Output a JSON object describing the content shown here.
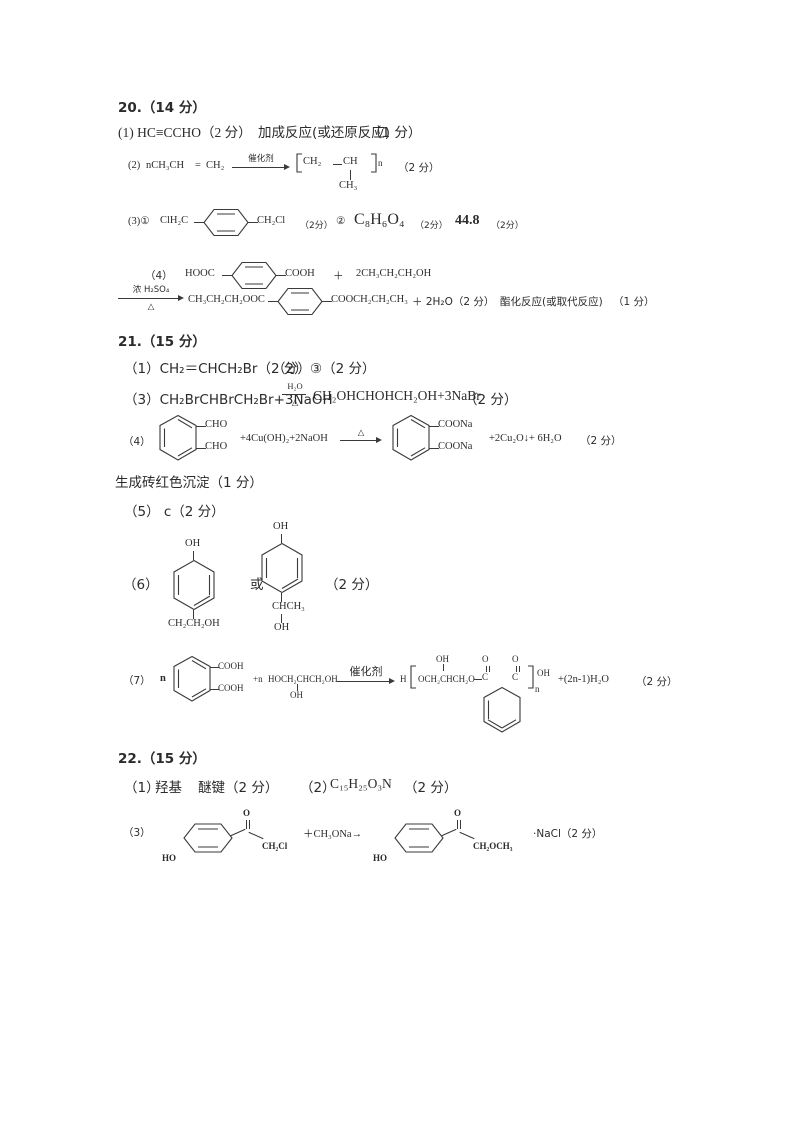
{
  "document": {
    "type": "chemistry-answer-key",
    "language": "zh-CN"
  },
  "q20": {
    "heading": "20.（14 分）",
    "line1_prefix": "(1) HC≡CCHO（2 分）",
    "line1_reaction_type": "加成反应(或还原反应)",
    "line1_score": "（1 分）",
    "line2_label": "(2)",
    "line2_reactant": "nCH₃CH",
    "line2_double_bond": "=",
    "line2_reactant_tail": "CH₂",
    "line2_condition": "催化剂",
    "line2_product_unit1": "CH₂",
    "line2_product_unit2": "CH",
    "line2_product_branch": "CH₃",
    "line2_product_sub": "n",
    "line2_score": "（2 分）",
    "line3_label": "(3)①",
    "line3_left": "ClH₂C",
    "line3_right": "CH₂Cl",
    "line3_score1": "（2分）",
    "line3_marker2": "②",
    "line3_formula2": "C₈H₆O₄",
    "line3_score2": "（2分）",
    "line3_value3": "44.8",
    "line3_score3": "（2分）",
    "line4_label": "（4）",
    "line4_left": "HOOC",
    "line4_right": "COOH",
    "line4_plus": "＋",
    "line4_alcohol": "2CH₃CH₂CH₂OH",
    "line5_cond_top": "浓 H₂SO₄",
    "line5_cond_bottom": "△",
    "line5_ester_left": "CH₃CH₂CH₂OOC",
    "line5_ester_right": "COOCH₂CH₂CH₃",
    "line5_water": "＋ 2H₂O（2 分）",
    "line5_reaction_type": "酯化反应(或取代反应)",
    "line5_score": "（1 分）"
  },
  "q21": {
    "heading": "21.（15 分）",
    "line1": "（1）CH₂＝CHCH₂Br（2 分）",
    "line1b_label": "（2）",
    "line1b_answer": "③（2 分）",
    "line3": "（3）CH₂BrCHBrCH₂Br+3NaOH",
    "line3_cond_top": "H₂O",
    "line3_cond_bottom": "△",
    "line3_product": "CH₂OHCHOHCH₂OH+3NaBr",
    "line3_score": "（2 分）",
    "line4_label": "（4）",
    "line4_sub_top": "CHO",
    "line4_sub_bottom": "CHO",
    "line4_reagents": "+4Cu(OH)₂+2NaOH",
    "line4_cond": "△",
    "line4_prod_top": "COONa",
    "line4_prod_bottom": "COONa",
    "line4_byproducts": "+2Cu₂O↓+ 6H₂O",
    "line4_score": "（2 分）",
    "line5_observation": "生成砖红色沉淀（1 分）",
    "line6": "（5） c（2 分）",
    "line7_label": "（6）",
    "line7_struct1_oh": "OH",
    "line7_struct1_chain": "CH₂CH₂OH",
    "line7_or": "或",
    "line7_struct2_oh": "OH",
    "line7_struct2_chain": "CHCH₃",
    "line7_struct2_oh2": "OH",
    "line7_score": "（2 分）",
    "line8_label": "（7）",
    "line8_n": "n",
    "line8_acid_top": "COOH",
    "line8_acid_bottom": "COOH",
    "line8_plus_n": "+n",
    "line8_diol": "HOCH₂CHCH₂OH",
    "line8_diol_oh": "OH",
    "line8_cond": "催化剂",
    "line8_prod_h": "H",
    "line8_prod_chain": "OCH₂CHCH₂O",
    "line8_prod_oh": "OH",
    "line8_prod_c1": "C",
    "line8_prod_c2": "C",
    "line8_prod_o1": "O",
    "line8_prod_o2": "O",
    "line8_prod_sub": "n",
    "line8_prod_oh_end": "OH",
    "line8_water": "+(2n-1)H₂O",
    "line8_score": "（2 分）"
  },
  "q22": {
    "heading": "22.（15 分）",
    "line1_label": "（1）",
    "line1_a": "羟基",
    "line1_b": "醚键（2 分）",
    "line1_c_label": "（2）",
    "line1_c": "C₁₅H₂₅O₃N",
    "line1_score": "（2 分）",
    "line2_label": "（3）",
    "line2_ho_left": "HO",
    "line2_o_left": "O",
    "line2_tail_left": "CH₂Cl",
    "line2_reagent": "＋CH₃ONa→",
    "line2_ho_right": "HO",
    "line2_o_right": "O",
    "line2_tail_right": "CH₂OCH₃",
    "line2_nacl": "·NaCl（2 分）"
  },
  "colors": {
    "ink": "#2b2b2b",
    "line": "#3a3a3a",
    "background": "#ffffff"
  }
}
